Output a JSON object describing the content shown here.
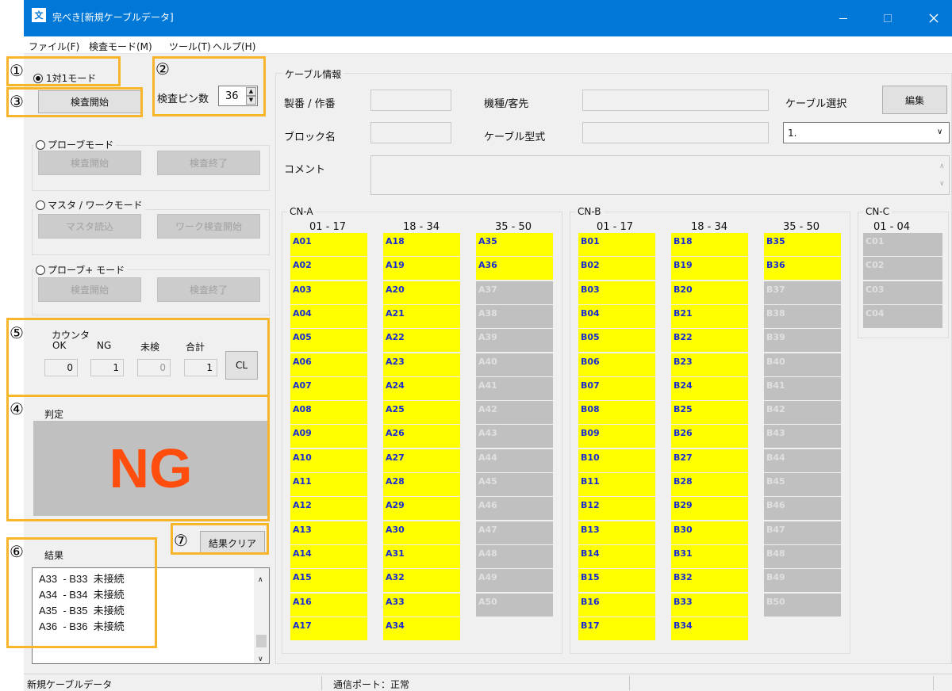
{
  "window": {
    "title": "完べき[新規ケーブルデータ]",
    "app_icon": "app-logo-icon"
  },
  "menu": [
    "ファイル(F)",
    "検査モード(M)",
    "ツール(T)",
    "ヘルプ(H)"
  ],
  "left": {
    "mode1": {
      "label": "1対1モード",
      "start": "検査開始",
      "pins_label": "検査ピン数",
      "pins": "36"
    },
    "probe": {
      "label": "プローブモード",
      "start": "検査開始",
      "end": "検査終了"
    },
    "master": {
      "label": "マスタ / ワークモード",
      "load": "マスタ読込",
      "start": "ワーク検査開始"
    },
    "probeplus": {
      "label": "プローブ+ モード",
      "start": "検査開始",
      "end": "検査終了"
    },
    "counter": {
      "title": "カウンタ",
      "ok_label": "OK",
      "ng_label": "NG",
      "unchecked_label": "未検",
      "total_label": "合計",
      "ok": "0",
      "ng": "1",
      "unchecked": "0",
      "total": "1",
      "clear": "CL"
    },
    "judge": {
      "title": "判定",
      "value": "NG",
      "color": "#ff4d0d"
    },
    "result": {
      "title": "結果",
      "clear": "結果クリア",
      "lines": [
        "A33  - B33  未接続",
        "A34  - B34  未接続",
        "A35  - B35  未接続",
        "A36  - B36  未接続"
      ]
    }
  },
  "cable": {
    "title": "ケーブル情報",
    "serial_label": "製番 / 作番",
    "model_label": "機種/客先",
    "select_label": "ケーブル選択",
    "edit": "編集",
    "block_label": "ブロック名",
    "type_label": "ケーブル型式",
    "select_value": "1.",
    "comment_label": "コメント"
  },
  "connectors": {
    "a": {
      "title": "CN-A",
      "ranges": [
        "01 - 17",
        "18 - 34",
        "35 - 50"
      ],
      "cols": [
        [
          "A01",
          "A02",
          "A03",
          "A04",
          "A05",
          "A06",
          "A07",
          "A08",
          "A09",
          "A10",
          "A11",
          "A12",
          "A13",
          "A14",
          "A15",
          "A16",
          "A17"
        ],
        [
          "A18",
          "A19",
          "A20",
          "A21",
          "A22",
          "A23",
          "A24",
          "A25",
          "A26",
          "A27",
          "A28",
          "A29",
          "A30",
          "A31",
          "A32",
          "A33",
          "A34"
        ],
        [
          "A35",
          "A36",
          "A37",
          "A38",
          "A39",
          "A40",
          "A41",
          "A42",
          "A43",
          "A44",
          "A45",
          "A46",
          "A47",
          "A48",
          "A49",
          "A50"
        ]
      ]
    },
    "b": {
      "title": "CN-B",
      "ranges": [
        "01 - 17",
        "18 - 34",
        "35 - 50"
      ],
      "cols": [
        [
          "B01",
          "B02",
          "B03",
          "B04",
          "B05",
          "B06",
          "B07",
          "B08",
          "B09",
          "B10",
          "B11",
          "B12",
          "B13",
          "B14",
          "B15",
          "B16",
          "B17"
        ],
        [
          "B18",
          "B19",
          "B20",
          "B21",
          "B22",
          "B23",
          "B24",
          "B25",
          "B26",
          "B27",
          "B28",
          "B29",
          "B30",
          "B31",
          "B32",
          "B33",
          "B34"
        ],
        [
          "B35",
          "B36",
          "B37",
          "B38",
          "B39",
          "B40",
          "B41",
          "B42",
          "B43",
          "B44",
          "B45",
          "B46",
          "B47",
          "B48",
          "B49",
          "B50"
        ]
      ]
    },
    "c": {
      "title": "CN-C",
      "ranges": [
        "01 - 04"
      ],
      "cols": [
        [
          "C01",
          "C02",
          "C03",
          "C04"
        ]
      ]
    },
    "active_count": 36,
    "on_color": "#ffff00",
    "off_color": "#c0c0c0"
  },
  "annotations": [
    "①",
    "②",
    "③",
    "④",
    "⑤",
    "⑥",
    "⑦"
  ],
  "status": {
    "left": "新規ケーブルデータ",
    "port": "通信ポート：正常"
  }
}
